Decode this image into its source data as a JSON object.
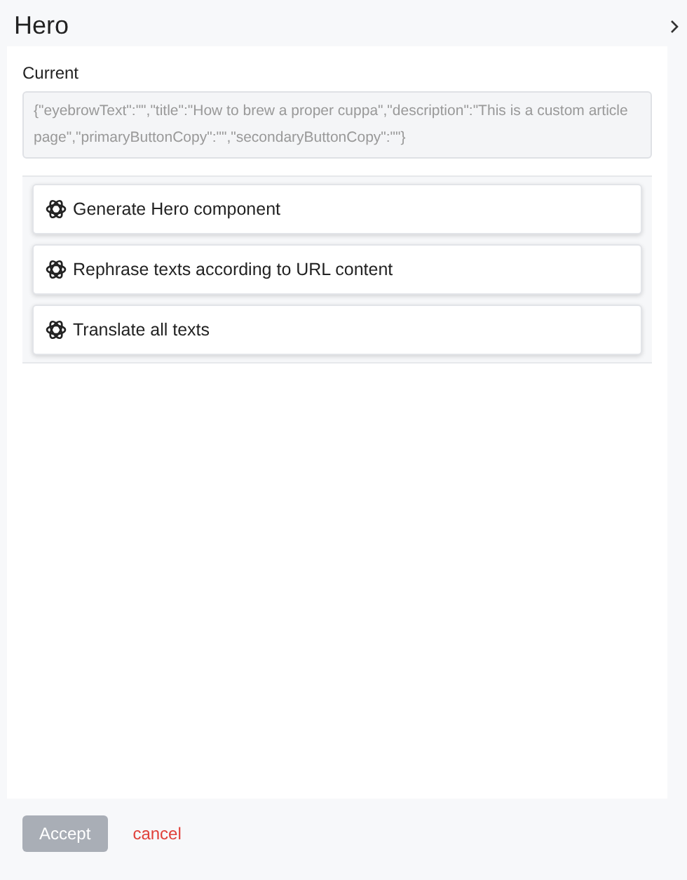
{
  "header": {
    "title": "Hero"
  },
  "current": {
    "label": "Current",
    "value": "{\"eyebrowText\":\"\",\"title\":\"How to brew a proper cuppa\",\"description\":\"This is a custom article page\",\"primaryButtonCopy\":\"\",\"secondaryButtonCopy\":\"\"}"
  },
  "actions": [
    {
      "label": "Generate Hero component"
    },
    {
      "label": "Rephrase texts according to URL content"
    },
    {
      "label": "Translate all texts"
    }
  ],
  "footer": {
    "accept": {
      "label": "Accept",
      "disabled": true
    },
    "cancel": "cancel"
  }
}
